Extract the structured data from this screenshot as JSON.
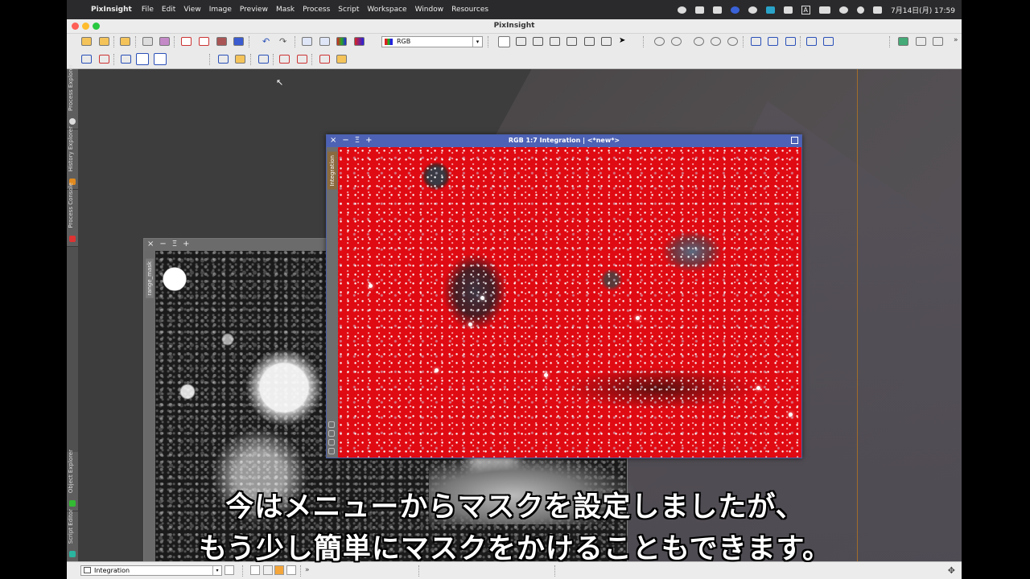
{
  "menubar": {
    "app_name": "PixInsight",
    "items": [
      "File",
      "Edit",
      "View",
      "Image",
      "Preview",
      "Mask",
      "Process",
      "Script",
      "Workspace",
      "Window",
      "Resources"
    ],
    "clock": "7月14日(月)  17:59",
    "input_method": "A"
  },
  "window": {
    "title": "PixInsight"
  },
  "toolbar": {
    "channel_select": "RGB"
  },
  "side_tabs": [
    {
      "label": "Process Explorer",
      "icon": "gear-icon"
    },
    {
      "label": "History Explorer",
      "icon": "history-icon"
    },
    {
      "label": "Process Console",
      "icon": "console-icon"
    },
    {
      "label": "Object Explorer",
      "icon": "object-icon"
    },
    {
      "label": "Script Editor",
      "icon": "script-icon"
    }
  ],
  "mask_window": {
    "id": "range_mask",
    "buttons": [
      "×",
      "−",
      "Ξ",
      "+"
    ]
  },
  "integration_window": {
    "title": "RGB 1:7 Integration | <*new*>",
    "id": "Integration",
    "buttons": [
      "×",
      "−",
      "Ξ",
      "+"
    ]
  },
  "subtitles": {
    "line1": "今はメニューからマスクを設定しましたが、",
    "line2": "もう少し簡単にマスクをかけることもできます。"
  },
  "statusbar": {
    "view_select": "Integration",
    "more": "»"
  },
  "colors": {
    "titlebar_active": "#4d62b5",
    "mask_overlay": "#e00a12",
    "traffic_red": "#fe5f57",
    "traffic_yellow": "#febc2e",
    "traffic_green": "#28c840"
  }
}
